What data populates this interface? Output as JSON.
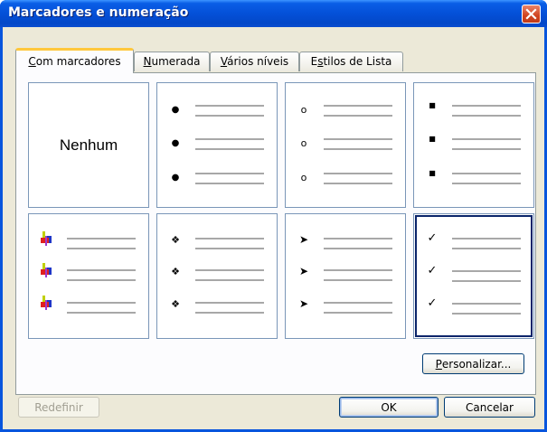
{
  "window": {
    "title": "Marcadores e numeração"
  },
  "tabs": [
    {
      "label": "Com marcadores",
      "accel": "C",
      "rest": "om marcadores",
      "active": true
    },
    {
      "label": "Numerada",
      "accel": "N",
      "rest": "umerada",
      "active": false
    },
    {
      "label": "Vários níveis",
      "accel": "V",
      "rest": "ários níveis",
      "active": false
    },
    {
      "label": "Estilos de Lista",
      "accel": "s",
      "pre": "E",
      "rest": "tilos de Lista",
      "active": false
    }
  ],
  "gallery": {
    "none_label": "Nenhum",
    "styles": [
      "none",
      "filled-circle",
      "hollow-circle",
      "filled-square",
      "colored-square",
      "four-diamond",
      "arrowhead",
      "checkmark"
    ],
    "selected": "checkmark",
    "glyphs": {
      "filled-circle": "●",
      "hollow-circle": "o",
      "filled-square": "■",
      "four-diamond": "❖",
      "arrowhead": "➤",
      "checkmark": "✓"
    }
  },
  "buttons": {
    "customize": {
      "label": "Personalizar...",
      "accel": "P",
      "rest": "ersonalizar..."
    },
    "reset": {
      "label": "Redefinir",
      "enabled": false
    },
    "ok": {
      "label": "OK"
    },
    "cancel": {
      "label": "Cancelar"
    }
  }
}
